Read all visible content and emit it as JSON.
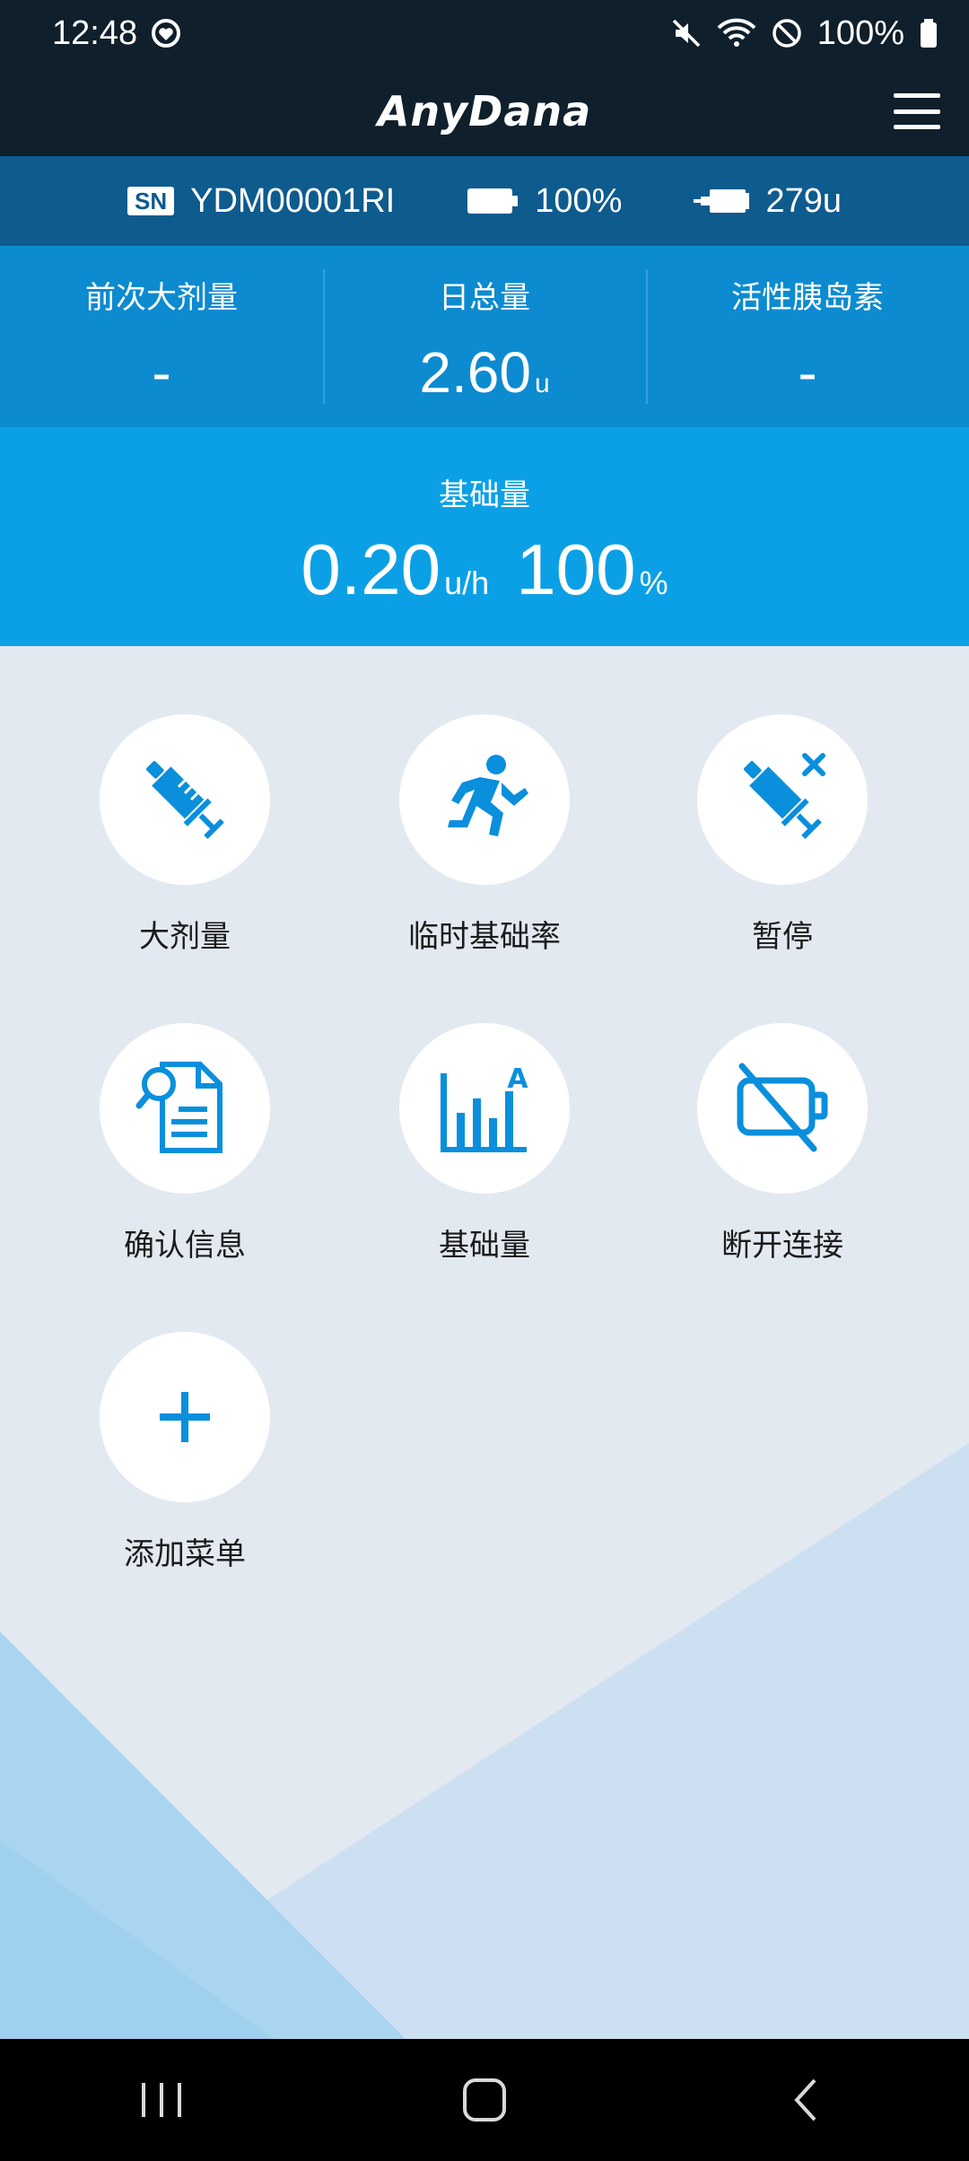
{
  "status_bar": {
    "time": "12:48",
    "battery": "100%",
    "icons": [
      "sync-heart-icon",
      "mute-icon",
      "wifi-icon",
      "do-not-disturb-icon",
      "battery-icon"
    ]
  },
  "app_bar": {
    "brand": "AnyDana",
    "menu_icon": "hamburger-menu-icon"
  },
  "device": {
    "sn_badge": "SN",
    "serial": "YDM00001RI",
    "battery": "100%",
    "reservoir": "279u"
  },
  "stats": [
    {
      "label": "前次大剂量",
      "value": "-",
      "unit": ""
    },
    {
      "label": "日总量",
      "value": "2.60",
      "unit": "u"
    },
    {
      "label": "活性胰岛素",
      "value": "-",
      "unit": ""
    }
  ],
  "basal": {
    "label": "基础量",
    "rate": "0.20",
    "rate_unit": "u/h",
    "percent": "100",
    "percent_unit": "%"
  },
  "actions": [
    {
      "label": "大剂量",
      "icon": "syringe-icon"
    },
    {
      "label": "临时基础率",
      "icon": "running-person-icon"
    },
    {
      "label": "暂停",
      "icon": "syringe-cancel-icon"
    },
    {
      "label": "确认信息",
      "icon": "document-search-icon"
    },
    {
      "label": "基础量",
      "icon": "bar-chart-icon"
    },
    {
      "label": "断开连接",
      "icon": "disconnect-icon"
    },
    {
      "label": "添加菜单",
      "icon": "plus-icon"
    }
  ],
  "colors": {
    "header": "#0f1f2b",
    "device_bar": "#0e5b8e",
    "stats": "#0d8bd0",
    "basal": "#0ba0e6",
    "icon_blue": "#0a8fdc",
    "background": "#e3e9f1"
  }
}
